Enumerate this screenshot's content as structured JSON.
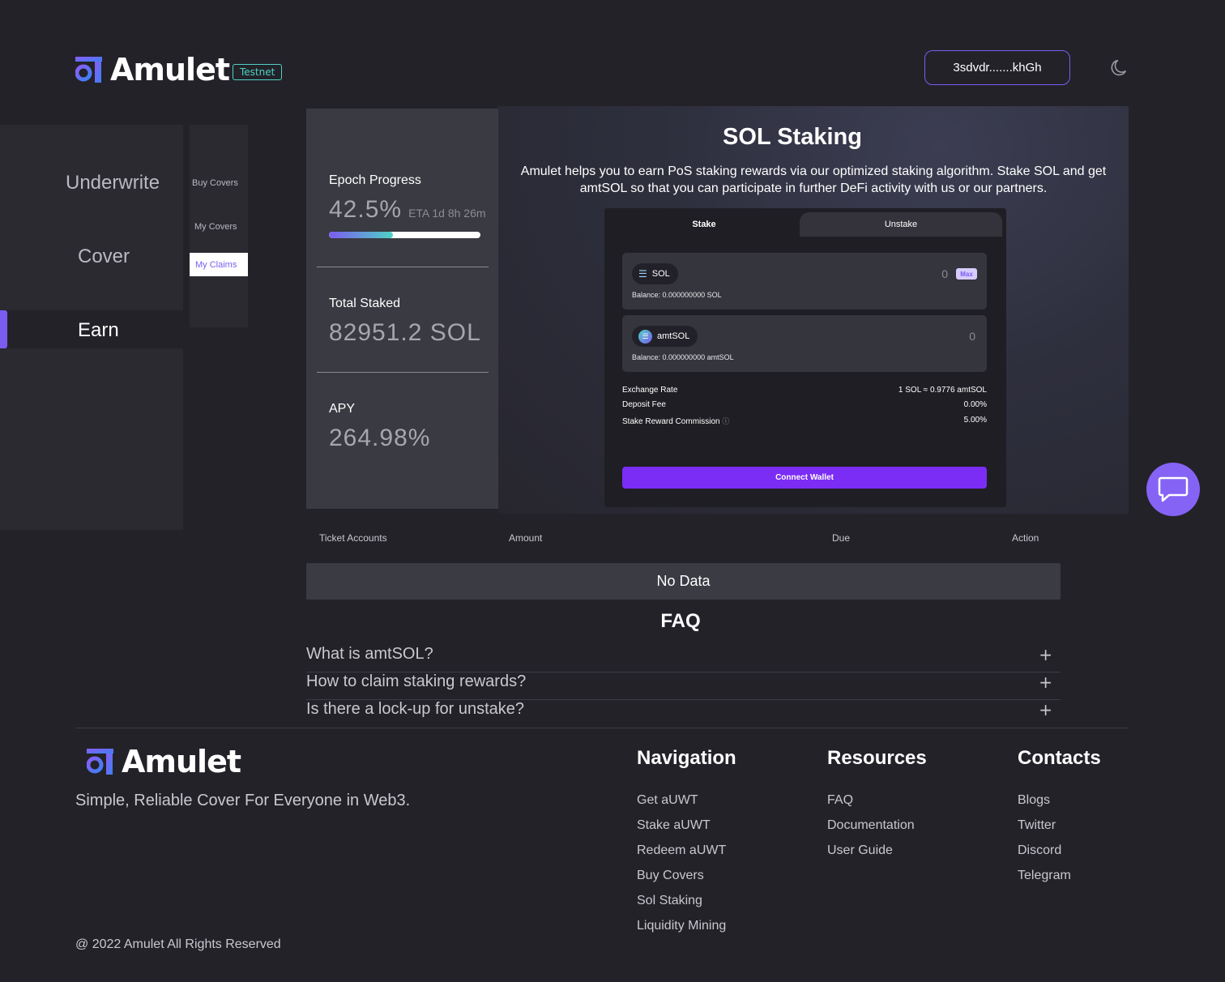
{
  "header": {
    "brand": "Amulet",
    "badge": "Testnet",
    "wallet": "3sdvdr.......khGh",
    "theme_icon": "moon-icon"
  },
  "sidebar": {
    "items": [
      {
        "label": "Underwrite"
      },
      {
        "label": "Cover"
      },
      {
        "label": "Earn"
      }
    ],
    "subitems": [
      {
        "label": "Buy Covers"
      },
      {
        "label": "My Covers"
      },
      {
        "label": "My Claims"
      }
    ]
  },
  "stats": {
    "epoch_label": "Epoch Progress",
    "epoch_value": "42.5%",
    "epoch_eta": "ETA 1d 8h 26m",
    "epoch_progress": 0.425,
    "staked_label": "Total Staked",
    "staked_value": "82951.2 SOL",
    "apy_label": "APY",
    "apy_value": "264.98%"
  },
  "hero": {
    "title": "SOL Staking",
    "description": "Amulet helps you to earn PoS staking rewards via our optimized staking algorithm. Stake SOL and get amtSOL so that you can participate in further DeFi activity with us or our partners."
  },
  "widget": {
    "tab_stake": "Stake",
    "tab_unstake": "Unstake",
    "from_token": "SOL",
    "from_amount": "0",
    "from_balance": "Balance: 0.000000000 SOL",
    "max_label": "Max",
    "to_token": "amtSOL",
    "to_amount": "0",
    "to_balance": "Balance: 0.000000000 amtSOL",
    "rows": [
      {
        "label": "Exchange Rate",
        "value": "1 SOL ≈ 0.9776 amtSOL"
      },
      {
        "label": "Deposit Fee",
        "value": "0.00%"
      },
      {
        "label": "Stake Reward Commission",
        "value": "5.00%"
      }
    ],
    "connect": "Connect Wallet"
  },
  "table": {
    "columns": [
      "Ticket Accounts",
      "Amount",
      "Due",
      "Action"
    ],
    "empty": "No Data"
  },
  "faq": {
    "title": "FAQ",
    "items": [
      {
        "q": "What is amtSOL?"
      },
      {
        "q": "How to claim staking rewards?"
      },
      {
        "q": "Is there a lock-up for unstake?"
      }
    ]
  },
  "footer": {
    "brand": "Amulet",
    "tagline": "Simple, Reliable Cover For Everyone in Web3.",
    "copyright": "@ 2022 Amulet All Rights Reserved",
    "navigation": {
      "title": "Navigation",
      "links": [
        "Get aUWT",
        "Stake aUWT",
        "Redeem aUWT",
        "Buy Covers",
        "Sol Staking",
        "Liquidity Mining"
      ]
    },
    "resources": {
      "title": "Resources",
      "links": [
        "FAQ",
        "Documentation",
        "User Guide"
      ]
    },
    "contacts": {
      "title": "Contacts",
      "links": [
        "Blogs",
        "Twitter",
        "Discord",
        "Telegram"
      ]
    }
  },
  "colors": {
    "accent": "#7b5cf0",
    "teal": "#4fd1c5",
    "background": "#232229",
    "button": "#7b2cf5"
  }
}
